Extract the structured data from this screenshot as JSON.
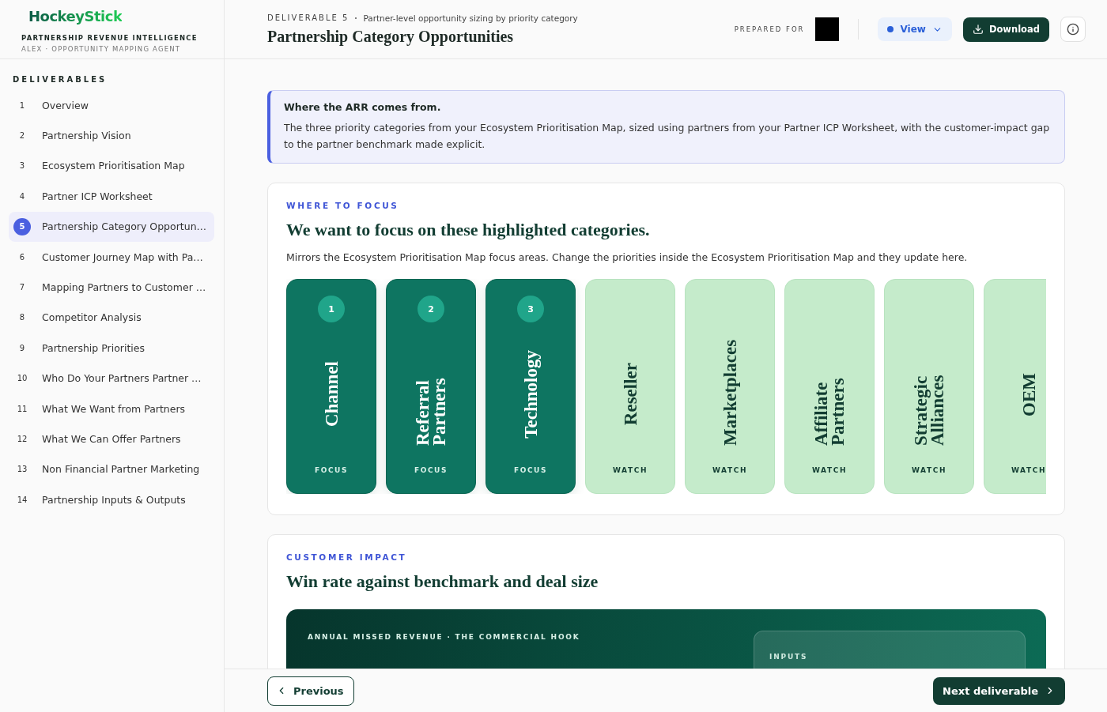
{
  "brand": {
    "logo": "HockeyStick",
    "tagline": "PARTNERSHIP REVENUE INTELLIGENCE",
    "agent": "ALEX · OPPORTUNITY MAPPING AGENT"
  },
  "sidebar": {
    "heading": "DELIVERABLES",
    "items": [
      {
        "number": "1",
        "label": "Overview",
        "selected": false
      },
      {
        "number": "2",
        "label": "Partnership Vision",
        "selected": false
      },
      {
        "number": "3",
        "label": "Ecosystem Prioritisation Map",
        "selected": false
      },
      {
        "number": "4",
        "label": "Partner ICP Worksheet",
        "selected": false
      },
      {
        "number": "5",
        "label": "Partnership Category Opportun…",
        "selected": true
      },
      {
        "number": "6",
        "label": "Customer Journey Map with Pa…",
        "selected": false
      },
      {
        "number": "7",
        "label": "Mapping Partners to Customer …",
        "selected": false
      },
      {
        "number": "8",
        "label": "Competitor Analysis",
        "selected": false
      },
      {
        "number": "9",
        "label": "Partnership Priorities",
        "selected": false
      },
      {
        "number": "10",
        "label": "Who Do Your Partners Partner …",
        "selected": false
      },
      {
        "number": "11",
        "label": "What We Want from Partners",
        "selected": false
      },
      {
        "number": "12",
        "label": "What We Can Offer Partners",
        "selected": false
      },
      {
        "number": "13",
        "label": "Non Financial Partner Marketing",
        "selected": false
      },
      {
        "number": "14",
        "label": "Partnership Inputs & Outputs",
        "selected": false
      }
    ]
  },
  "header": {
    "eyebrow": "DELIVERABLE 5",
    "subtitle": "Partner-level opportunity sizing by priority category",
    "title": "Partnership Category Opportunities",
    "prepared_for": "PREPARED FOR",
    "view_button": "View",
    "download_button": "Download"
  },
  "callout": {
    "title": "Where the ARR comes from.",
    "body": "The three priority categories from your Ecosystem Prioritisation Map, sized using partners from your Partner ICP Worksheet, with the customer-impact gap to the partner benchmark made explicit."
  },
  "focus_section": {
    "eyebrow": "WHERE TO FOCUS",
    "title": "We want to focus on these highlighted categories.",
    "description": "Mirrors the Ecosystem Prioritisation Map focus areas. Change the priorities inside the Ecosystem Prioritisation Map and they update here.",
    "categories": [
      {
        "name": "Channel",
        "kind": "focus",
        "rank": "1",
        "status": "FOCUS"
      },
      {
        "name": "Referral Partners",
        "kind": "focus",
        "rank": "2",
        "status": "FOCUS"
      },
      {
        "name": "Technology",
        "kind": "focus",
        "rank": "3",
        "status": "FOCUS"
      },
      {
        "name": "Reseller",
        "kind": "watch",
        "status": "WATCH"
      },
      {
        "name": "Marketplaces",
        "kind": "watch",
        "status": "WATCH"
      },
      {
        "name": "Affiliate Partners",
        "kind": "watch",
        "status": "WATCH"
      },
      {
        "name": "Strategic Alliances",
        "kind": "watch",
        "status": "WATCH"
      },
      {
        "name": "OEM",
        "kind": "watch",
        "status": "WATCH"
      }
    ]
  },
  "impact_section": {
    "eyebrow": "CUSTOMER IMPACT",
    "title": "Win rate against benchmark and deal size",
    "banner_label": "ANNUAL MISSED REVENUE · THE COMMERCIAL HOOK",
    "inputs_label": "INPUTS"
  },
  "footer": {
    "previous": "Previous",
    "next": "Next deliverable"
  }
}
